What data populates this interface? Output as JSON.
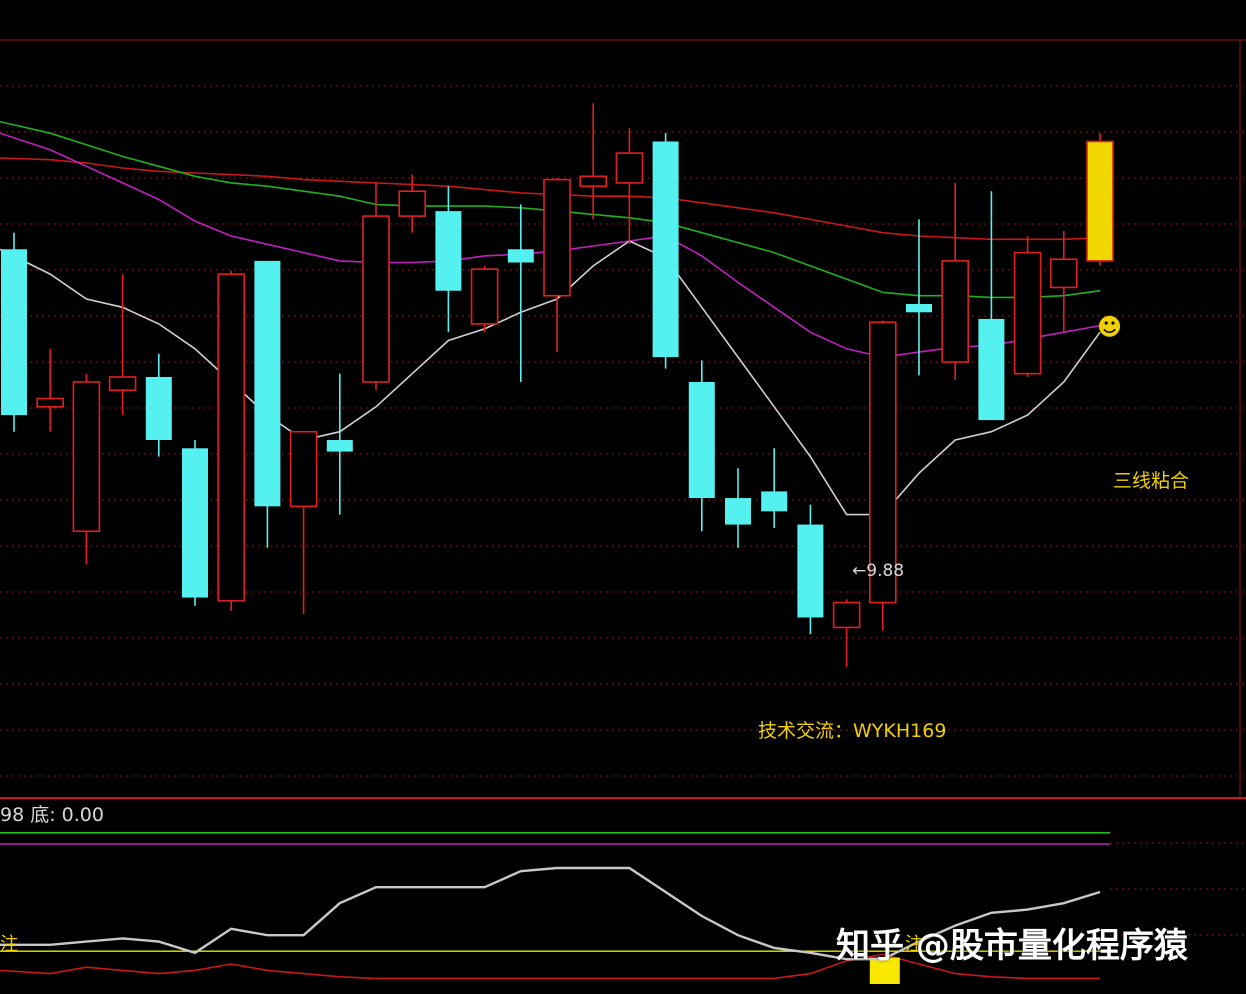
{
  "chart_data": [
    {
      "type": "candlestick",
      "title": "",
      "xlabel": "",
      "ylabel": "",
      "ylim": [
        8.9,
        13.0
      ],
      "grid": true,
      "colors": {
        "up": "#e02020",
        "down": "#55f0f0",
        "ma_red": "#c81818",
        "ma_green": "#20b020",
        "ma_purple": "#c020c0",
        "ma_white": "#d0d0d0",
        "signal": "#f0d800",
        "background": "#000000",
        "grid": "#9a1010"
      },
      "candles": [
        {
          "o": 12.1,
          "h": 12.2,
          "l": 11.0,
          "c": 11.1,
          "dir": "down"
        },
        {
          "o": 11.2,
          "h": 11.5,
          "l": 11.0,
          "c": 11.15,
          "dir": "up"
        },
        {
          "o": 10.4,
          "h": 11.35,
          "l": 10.2,
          "c": 11.3,
          "dir": "up"
        },
        {
          "o": 11.25,
          "h": 11.95,
          "l": 11.1,
          "c": 11.33,
          "dir": "up"
        },
        {
          "o": 11.33,
          "h": 11.47,
          "l": 10.85,
          "c": 10.95,
          "dir": "down"
        },
        {
          "o": 10.9,
          "h": 10.95,
          "l": 9.95,
          "c": 10.0,
          "dir": "down"
        },
        {
          "o": 9.98,
          "h": 11.97,
          "l": 9.92,
          "c": 11.95,
          "dir": "up"
        },
        {
          "o": 12.03,
          "h": 12.03,
          "l": 10.3,
          "c": 10.55,
          "dir": "down"
        },
        {
          "o": 10.55,
          "h": 11.0,
          "l": 9.9,
          "c": 11.0,
          "dir": "up"
        },
        {
          "o": 10.95,
          "h": 11.35,
          "l": 10.5,
          "c": 10.88,
          "dir": "down"
        },
        {
          "o": 11.3,
          "h": 12.5,
          "l": 11.25,
          "c": 12.3,
          "dir": "up"
        },
        {
          "o": 12.3,
          "h": 12.55,
          "l": 12.2,
          "c": 12.45,
          "dir": "up"
        },
        {
          "o": 12.33,
          "h": 12.48,
          "l": 11.6,
          "c": 11.85,
          "dir": "down"
        },
        {
          "o": 11.65,
          "h": 12.0,
          "l": 11.6,
          "c": 11.98,
          "dir": "up"
        },
        {
          "o": 12.1,
          "h": 12.37,
          "l": 11.3,
          "c": 12.02,
          "dir": "down"
        },
        {
          "o": 11.82,
          "h": 12.53,
          "l": 11.48,
          "c": 12.52,
          "dir": "up"
        },
        {
          "o": 12.48,
          "h": 12.98,
          "l": 12.28,
          "c": 12.54,
          "dir": "up"
        },
        {
          "o": 12.5,
          "h": 12.83,
          "l": 12.13,
          "c": 12.68,
          "dir": "up"
        },
        {
          "o": 12.75,
          "h": 12.8,
          "l": 11.38,
          "c": 11.45,
          "dir": "down"
        },
        {
          "o": 11.3,
          "h": 11.43,
          "l": 10.4,
          "c": 10.6,
          "dir": "down"
        },
        {
          "o": 10.6,
          "h": 10.78,
          "l": 10.3,
          "c": 10.44,
          "dir": "down"
        },
        {
          "o": 10.64,
          "h": 10.9,
          "l": 10.42,
          "c": 10.52,
          "dir": "down"
        },
        {
          "o": 10.44,
          "h": 10.56,
          "l": 9.78,
          "c": 9.88,
          "dir": "down"
        },
        {
          "o": 9.82,
          "h": 9.99,
          "l": 9.58,
          "c": 9.97,
          "dir": "up"
        },
        {
          "o": 9.97,
          "h": 11.67,
          "l": 9.8,
          "c": 11.66,
          "dir": "up"
        },
        {
          "o": 11.77,
          "h": 12.28,
          "l": 11.34,
          "c": 11.72,
          "dir": "down"
        },
        {
          "o": 11.42,
          "h": 12.5,
          "l": 11.31,
          "c": 12.03,
          "dir": "up"
        },
        {
          "o": 11.68,
          "h": 12.45,
          "l": 11.1,
          "c": 11.07,
          "dir": "down"
        },
        {
          "o": 11.35,
          "h": 12.18,
          "l": 11.33,
          "c": 12.08,
          "dir": "up"
        },
        {
          "o": 11.87,
          "h": 12.21,
          "l": 11.6,
          "c": 12.04,
          "dir": "up"
        },
        {
          "o": 12.03,
          "h": 12.8,
          "l": 12.0,
          "c": 12.75,
          "dir": "signal"
        }
      ],
      "ma": [
        {
          "color": "#c81818",
          "values": [
            12.65,
            12.64,
            12.62,
            12.59,
            12.57,
            12.56,
            12.55,
            12.54,
            12.52,
            12.51,
            12.5,
            12.49,
            12.48,
            12.46,
            12.44,
            12.43,
            12.42,
            12.42,
            12.41,
            12.38,
            12.35,
            12.32,
            12.28,
            12.24,
            12.2,
            12.18,
            12.17,
            12.16,
            12.16,
            12.16,
            12.17
          ]
        },
        {
          "color": "#20b020",
          "values": [
            12.87,
            12.8,
            12.73,
            12.66,
            12.6,
            12.54,
            12.5,
            12.48,
            12.45,
            12.42,
            12.37,
            12.36,
            12.36,
            12.36,
            12.35,
            12.33,
            12.31,
            12.29,
            12.26,
            12.2,
            12.14,
            12.08,
            12.0,
            11.92,
            11.84,
            11.82,
            11.82,
            11.81,
            11.81,
            11.82,
            11.85
          ]
        },
        {
          "color": "#c020c0",
          "values": [
            12.8,
            12.7,
            12.6,
            12.5,
            12.4,
            12.27,
            12.18,
            12.13,
            12.08,
            12.03,
            12.02,
            12.02,
            12.03,
            12.06,
            12.07,
            12.09,
            12.12,
            12.15,
            12.18,
            12.06,
            11.9,
            11.75,
            11.6,
            11.5,
            11.45,
            11.48,
            11.51,
            11.52,
            11.56,
            11.6,
            11.64
          ]
        },
        {
          "color": "#d0d0d0",
          "values": [
            12.1,
            11.95,
            11.8,
            11.75,
            11.65,
            11.5,
            11.3,
            11.1,
            10.95,
            11.0,
            11.15,
            11.35,
            11.55,
            11.62,
            11.72,
            11.8,
            12.0,
            12.15,
            12.05,
            11.75,
            11.45,
            11.15,
            10.85,
            10.5,
            10.5,
            10.75,
            10.95,
            11.0,
            11.1,
            11.3,
            11.6
          ]
        }
      ],
      "low_label": "9.88",
      "annotation_right": "三线粘合",
      "annotation_contact": "技术交流：WYKH169"
    },
    {
      "type": "line",
      "title": "",
      "header_label": "98 底: 0.00",
      "ylim": [
        0,
        100
      ],
      "colors": {
        "green": "#20c020",
        "purple": "#c020c0",
        "yellow": "#e8e800",
        "white": "#c8c8c8",
        "red": "#c81818",
        "bar": "#f8e800"
      },
      "levels": {
        "green": 92,
        "purple": 85,
        "yellow": 18
      },
      "white_line": {
        "x": [
          0,
          1,
          2,
          3,
          4,
          5,
          6,
          7,
          8,
          9,
          10,
          11,
          12,
          13,
          14,
          15,
          16,
          17,
          18,
          19,
          20,
          21,
          22,
          23,
          24,
          25,
          26,
          27,
          28,
          29,
          30
        ],
        "values": [
          22,
          22,
          24,
          26,
          24,
          17,
          32,
          28,
          28,
          48,
          58,
          58,
          58,
          58,
          68,
          70,
          70,
          70,
          55,
          40,
          28,
          20,
          17,
          13,
          13,
          24,
          34,
          42,
          44,
          48,
          55
        ]
      },
      "red_line": {
        "x": [
          0,
          1,
          2,
          3,
          4,
          5,
          6,
          7,
          8,
          9,
          10,
          11,
          12,
          13,
          14,
          15,
          16,
          17,
          18,
          19,
          20,
          21,
          22,
          23,
          24,
          25,
          26,
          27,
          28,
          29,
          30
        ],
        "values": [
          6,
          4,
          8,
          6,
          4,
          6,
          10,
          6,
          4,
          2,
          1,
          1,
          1,
          1,
          1,
          1,
          1,
          1,
          1,
          1,
          1,
          1,
          4,
          12,
          16,
          10,
          4,
          2,
          1,
          1,
          1
        ]
      },
      "signal_bar_index": 24,
      "signal_bar_value": 14,
      "side_text": "注"
    }
  ],
  "watermark": "知乎 @股市量化程序猿",
  "smiley_icon": "smiley-icon"
}
